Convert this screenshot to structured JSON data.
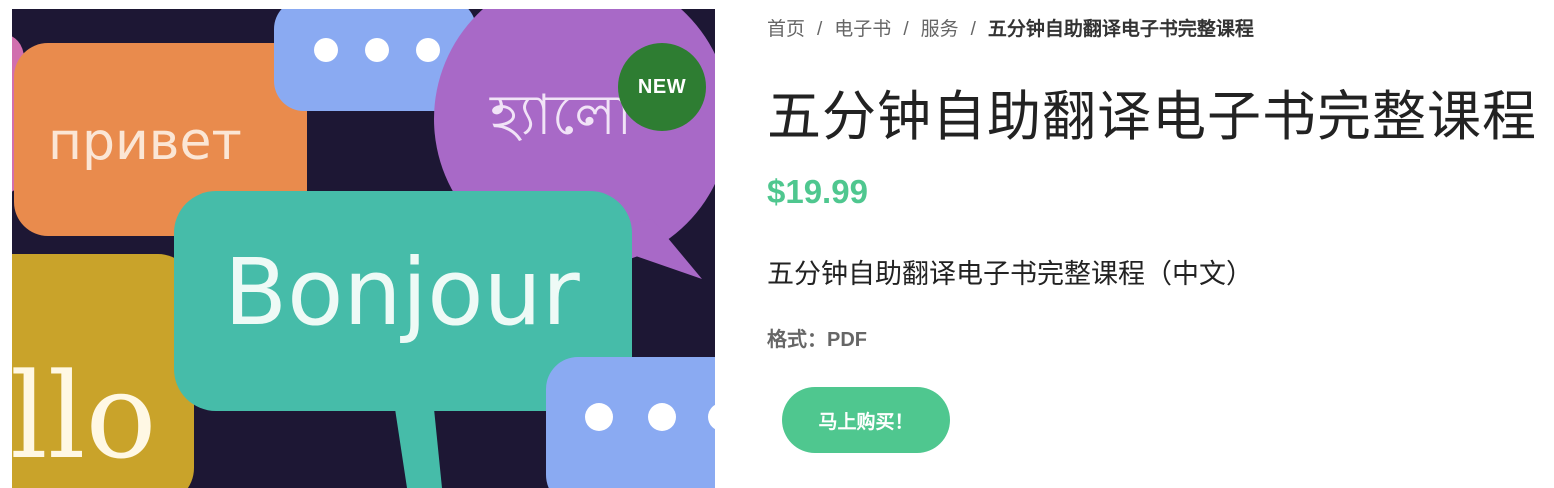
{
  "image": {
    "badge": "NEW",
    "bubble_texts": {
      "russian": "привет",
      "bengali": "হ্যালো",
      "french": "Bonjour",
      "hello_fragment": "llo"
    }
  },
  "breadcrumb": {
    "items": [
      "首页",
      "电子书",
      "服务"
    ],
    "separator": "/",
    "current": "五分钟自助翻译电子书完整课程"
  },
  "product": {
    "title": "五分钟自助翻译电子书完整课程",
    "price": "$19.99",
    "short_description": "五分钟自助翻译电子书完整课程（中文）",
    "format": "格式：PDF",
    "buy_label": "马上购买！"
  },
  "colors": {
    "accent": "#4fc78f",
    "badge": "#2e7d32",
    "image_background": "#1d1734"
  }
}
